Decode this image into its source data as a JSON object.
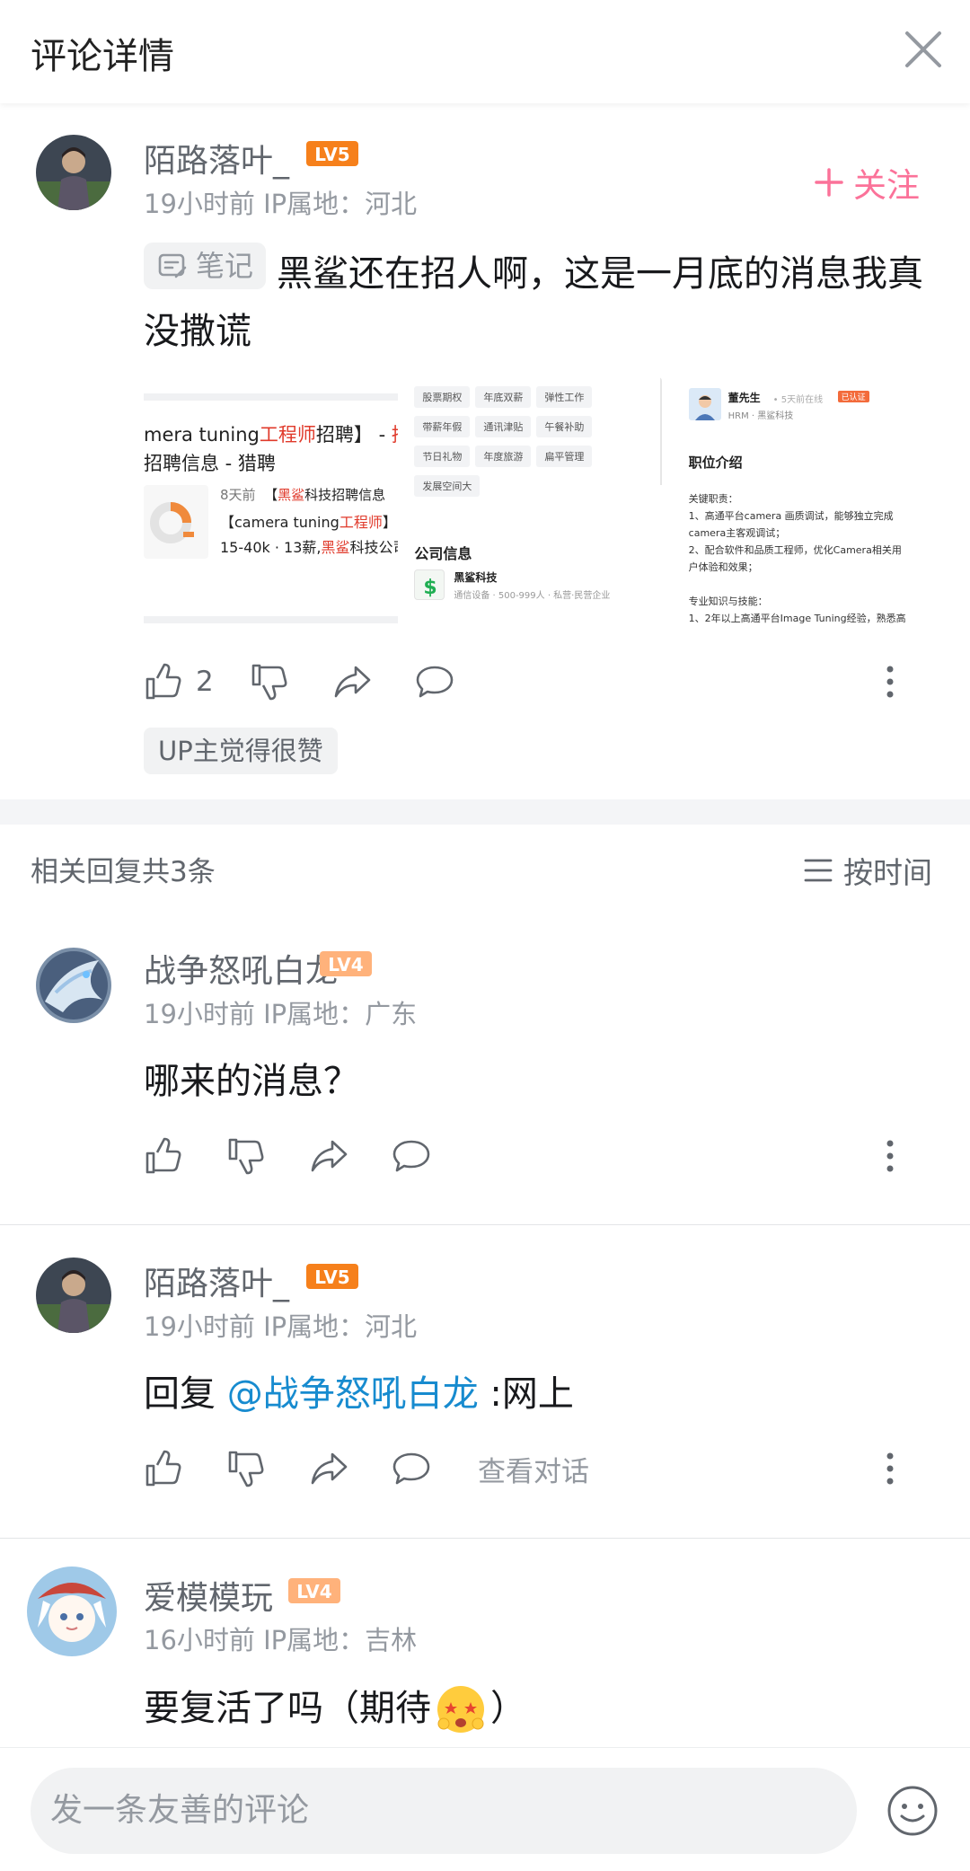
{
  "header": {
    "title": "评论详情"
  },
  "main_comment": {
    "username": "陌路落叶_",
    "level": "LV5",
    "meta": "19小时前 IP属地：河北",
    "follow_label": "关注",
    "note_label": "笔记",
    "text": "黑鲨还在招人啊，这是一月底的消息我真没撒谎",
    "likes": "2",
    "up_badge": "UP主觉得很赞",
    "image1": {
      "title_a": "mera tuning",
      "title_b": "工程师",
      "title_c": "招聘】 - ",
      "title_d": "招聘信息 - 猎聘",
      "line_time": "8天前",
      "line1_a": "【",
      "line1_b": "黑鲨",
      "line1_c": "科技招聘信息",
      "line2_a": "【camera tuning",
      "line2_b": "工程师",
      "line2_c": "】",
      "line3_a": "15-40k · 13薪,",
      "line3_b": "黑鲨",
      "line3_c": "科技公司"
    },
    "image2": {
      "tags": [
        "股票期权",
        "年底双薪",
        "弹性工作",
        "带薪年假",
        "通讯津贴",
        "午餐补助",
        "节日礼物",
        "年度旅游",
        "扁平管理",
        "发展空间大"
      ],
      "section": "公司信息",
      "company": "黑鲨科技",
      "company_meta": "通信设备 · 500-999人 · 私营·民营企业"
    },
    "image3": {
      "hr_name": "董先生",
      "hr_online": "5天前在线",
      "hr_badge": "已认证",
      "hr_role": "HRM · 黑鲨科技",
      "section": "职位介绍",
      "lines": [
        "关键职责：",
        "1、高通平台camera 画质调试，能够独立完成",
        "camera主客观调试；",
        "2、配合软件和品质工程师，优化Camera相关用",
        "户体验和效果；",
        "",
        "专业知识与技能：",
        "1、2年以上高通平台Image Tuning经验，熟悉高"
      ]
    }
  },
  "replies_header": {
    "count_label": "相关回复共3条",
    "sort_label": "按时间"
  },
  "replies": [
    {
      "username": "战争怒吼白龙",
      "level": "LV4",
      "meta": "19小时前 IP属地：广东",
      "text": "哪来的消息？"
    },
    {
      "username": "陌路落叶_",
      "level": "LV5",
      "meta": "19小时前 IP属地：河北",
      "prefix": "回复 ",
      "mention": "@战争怒吼白龙",
      "suffix": " :网上",
      "view_conversation": "查看对话"
    },
    {
      "username": "爱模模玩",
      "level": "LV4",
      "meta": "16小时前 IP属地：吉林",
      "text_before": "要复活了吗（期待",
      "text_after": "）"
    }
  ],
  "composer": {
    "placeholder": "发一条友善的评论"
  },
  "colors": {
    "accent": "#fb7299",
    "lv5": "#f6801b",
    "lv4": "#ffb27b",
    "mention": "#178bcf"
  }
}
